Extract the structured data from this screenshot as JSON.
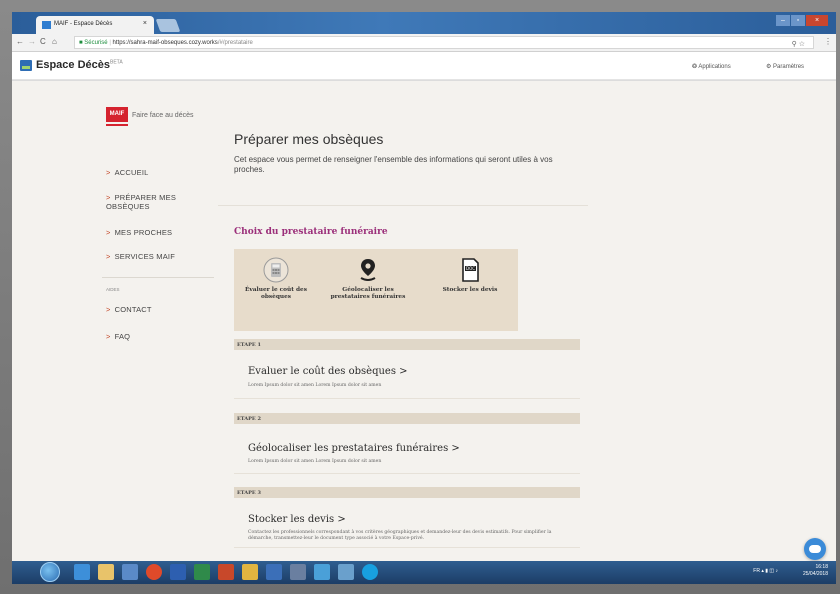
{
  "browser": {
    "tab_title": "MAIF - Espace Décès",
    "tab_close": "×",
    "secure_label": "Sécurisé",
    "url_host": "https://sahra-maif-obseques.cozy.works",
    "url_path": "/#/prestataire"
  },
  "app": {
    "title": "Espace Décès",
    "beta": "BETA",
    "applications_label": "Applications",
    "settings_label": "Paramètres"
  },
  "sidebar": {
    "brand_logo": "MAIF",
    "brand_tagline": "Faire face au décès",
    "items": [
      {
        "label": "ACCUEIL"
      },
      {
        "label": "PRÉPARER MES OBSÈQUES"
      },
      {
        "label": "MES PROCHES"
      },
      {
        "label": "SERVICES MAIF"
      }
    ],
    "section_label": "AIDES",
    "help_items": [
      {
        "label": "CONTACT"
      },
      {
        "label": "FAQ"
      }
    ]
  },
  "content": {
    "page_title": "Préparer mes obsèques",
    "page_description": "Cet espace vous permet de renseigner l'ensemble des informations qui seront utiles à vos proches.",
    "section_title": "Choix du prestataire funéraire",
    "features": [
      {
        "label": "Évaluer le coût des obsèques",
        "icon": "calculator-icon"
      },
      {
        "label": "Géolocaliser les prestataires funéraires",
        "icon": "map-pin-icon"
      },
      {
        "label": "Stocker les devis",
        "icon": "document-icon"
      }
    ],
    "document_icon_text": "DOC",
    "steps": [
      {
        "step": "ETAPE 1",
        "title": "Evaluer le coût des obsèques >",
        "desc": "Lorem Ipsum dolor sit amen Lorem Ipsum dolor sit amen"
      },
      {
        "step": "ETAPE 2",
        "title": "Géolocaliser les prestataires funéraires >",
        "desc": "Lorem Ipsum dolor sit amen Lorem Ipsum dolor sit amen"
      },
      {
        "step": "ETAPE 3",
        "title": "Stocker les devis >",
        "desc": "Contactez les professionnels correspondant à vos critères géographiques et demandez-leur des devis estimatifs. Pour simplifier la démarche, transmettez-leur le document type associé à votre Espace-privé."
      }
    ]
  },
  "taskbar": {
    "lang": "FR",
    "time": "16:18",
    "date": "25/04/2018"
  },
  "colors": {
    "accent_purple": "#9b2f7a",
    "maif_red": "#d5232e",
    "chevron": "#c04020"
  }
}
